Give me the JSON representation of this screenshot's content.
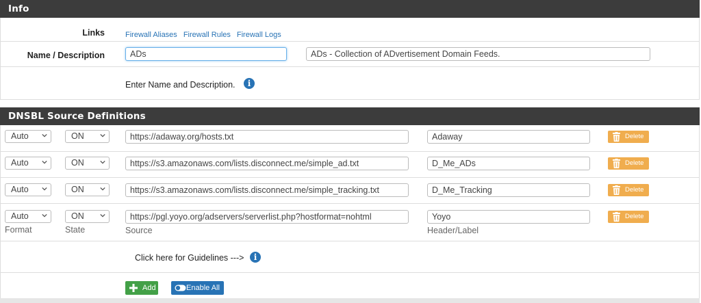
{
  "info_panel": {
    "title": "Info",
    "links_label": "Links",
    "links": [
      "Firewall Aliases",
      "Firewall Rules",
      "Firewall Logs"
    ],
    "name_label": "Name / Description",
    "name_value": "ADs",
    "description_value": "ADs - Collection of ADvertisement Domain Feeds.",
    "help_text": "Enter Name and Description."
  },
  "dnsbl_panel": {
    "title": "DNSBL Source Definitions",
    "rows": [
      {
        "format": "Auto",
        "state": "ON",
        "source": "https://adaway.org/hosts.txt",
        "header": "Adaway",
        "delete_label": "Delete"
      },
      {
        "format": "Auto",
        "state": "ON",
        "source": "https://s3.amazonaws.com/lists.disconnect.me/simple_ad.txt",
        "header": "D_Me_ADs",
        "delete_label": "Delete"
      },
      {
        "format": "Auto",
        "state": "ON",
        "source": "https://s3.amazonaws.com/lists.disconnect.me/simple_tracking.txt",
        "header": "D_Me_Tracking",
        "delete_label": "Delete"
      },
      {
        "format": "Auto",
        "state": "ON",
        "source": "https://pgl.yoyo.org/adservers/serverlist.php?hostformat=nohtml",
        "header": "Yoyo",
        "delete_label": "Delete"
      }
    ],
    "captions": {
      "format": "Format",
      "state": "State",
      "source": "Source",
      "header": "Header/Label"
    },
    "guidelines_text": "Click here for Guidelines --->",
    "add_label": "Add",
    "enable_all_label": "Enable All",
    "colors": {
      "header_bg": "#3c3c3c",
      "delete": "#f0ad4e",
      "add": "#43a047",
      "enable_all": "#2873b5",
      "info": "#2873b5"
    }
  }
}
